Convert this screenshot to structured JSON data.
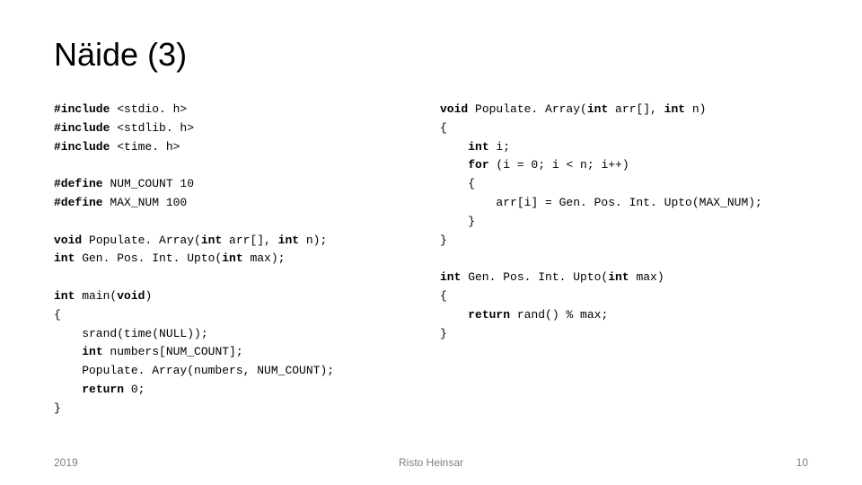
{
  "title": "Näide (3)",
  "code_left": {
    "l01a": "#include",
    "l01b": " <stdio. h>",
    "l02a": "#include",
    "l02b": " <stdlib. h>",
    "l03a": "#include",
    "l03b": " <time. h>",
    "blank1": "",
    "l04a": "#define",
    "l04b": " NUM_COUNT 10",
    "l05a": "#define",
    "l05b": " MAX_NUM 100",
    "blank2": "",
    "l06a": "void",
    "l06b": " Populate. Array(",
    "l06c": "int",
    "l06d": " arr[], ",
    "l06e": "int",
    "l06f": " n);",
    "l07a": "int",
    "l07b": " Gen. Pos. Int. Upto(",
    "l07c": "int",
    "l07d": " max);",
    "blank3": "",
    "l08a": "int",
    "l08b": " main(",
    "l08c": "void",
    "l08d": ")",
    "l09": "{",
    "l10": "    srand(time(NULL));",
    "l11a": "    ",
    "l11b": "int",
    "l11c": " numbers[NUM_COUNT];",
    "l12": "    Populate. Array(numbers, NUM_COUNT);",
    "l13a": "    ",
    "l13b": "return",
    "l13c": " 0;",
    "l14": "}"
  },
  "code_right": {
    "r01a": "void",
    "r01b": " Populate. Array(",
    "r01c": "int",
    "r01d": " arr[], ",
    "r01e": "int",
    "r01f": " n)",
    "r02": "{",
    "r03a": "    ",
    "r03b": "int",
    "r03c": " i;",
    "r04a": "    ",
    "r04b": "for",
    "r04c": " (i = 0; i < n; i++)",
    "r05": "    {",
    "r06": "        arr[i] = Gen. Pos. Int. Upto(MAX_NUM);",
    "r07": "    }",
    "r08": "}",
    "blank1": "",
    "r09a": "int",
    "r09b": " Gen. Pos. Int. Upto(",
    "r09c": "int",
    "r09d": " max)",
    "r10": "{",
    "r11a": "    ",
    "r11b": "return",
    "r11c": " rand() % max;",
    "r12": "}"
  },
  "footer": {
    "left": "2019",
    "center": "Risto Heinsar",
    "right": "10"
  }
}
